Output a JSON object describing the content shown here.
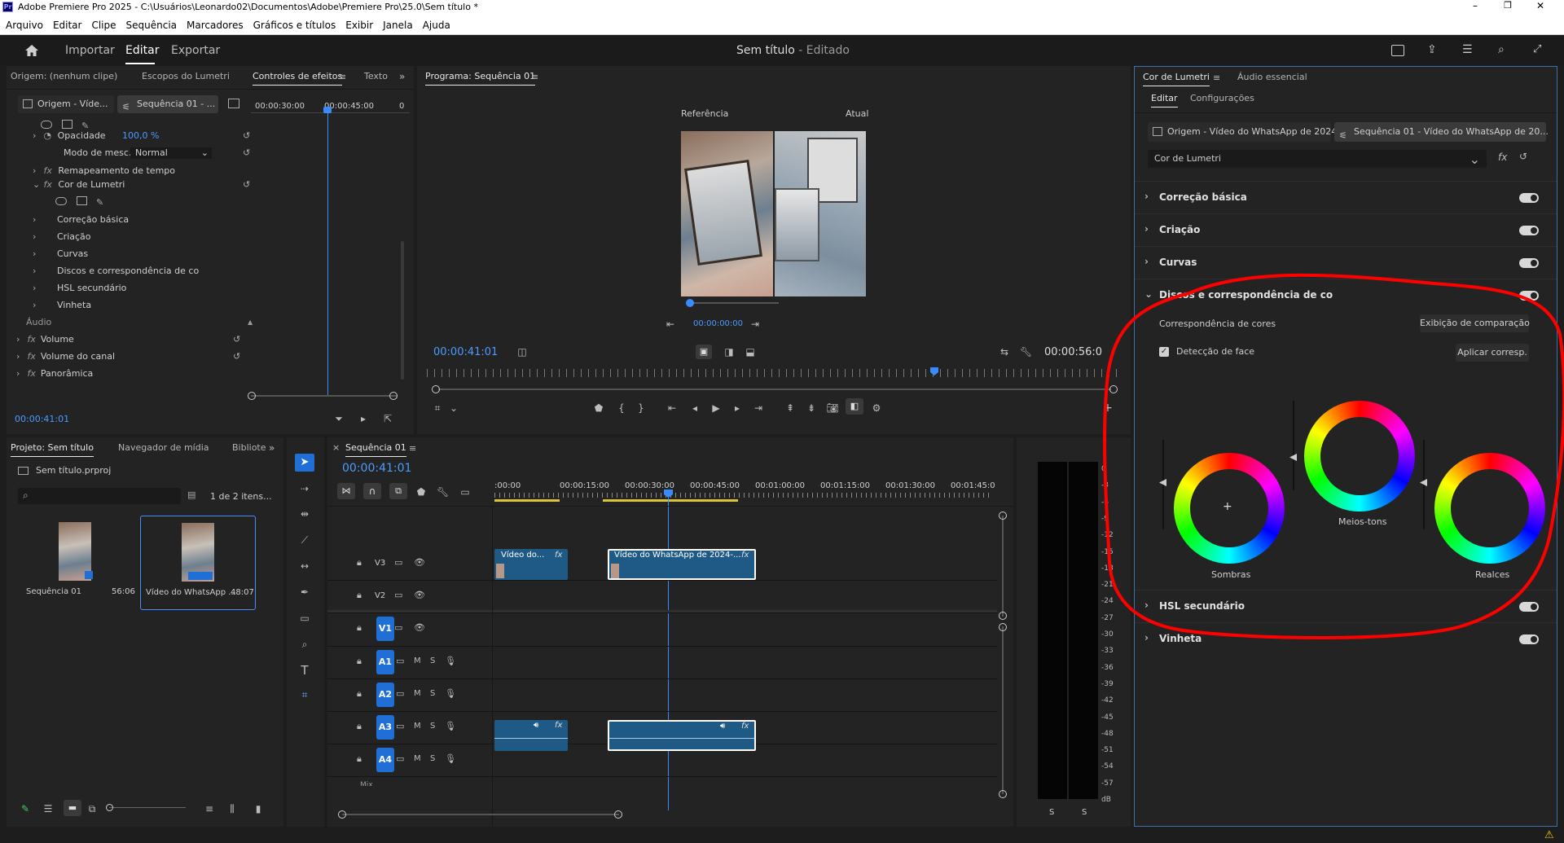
{
  "titlebar": {
    "app_title": "Adobe Premiere Pro 2025 - C:\\Usuários\\Leonardo02\\Documentos\\Adobe\\Premiere Pro\\25.0\\Sem título *"
  },
  "menu": [
    "Arquivo",
    "Editar",
    "Clipe",
    "Sequência",
    "Marcadores",
    "Gráficos e títulos",
    "Exibir",
    "Janela",
    "Ajuda"
  ],
  "workspace": {
    "tabs": [
      "Importar",
      "Editar",
      "Exportar"
    ],
    "active": "Editar",
    "doc_title": "Sem título",
    "doc_status": " - Editado"
  },
  "source_panel": {
    "tabs": [
      "Origem: (nenhum clipe)",
      "Escopos do Lumetri",
      "Controles de efeitos",
      "Texto"
    ],
    "clip_a": "Origem - Víde...",
    "clip_b": "Sequência 01 - ...",
    "ruler": [
      "00:00:30:00",
      "00:00:45:00",
      "0"
    ],
    "opacity_label": "Opacidade",
    "opacity_value": "100,0 %",
    "blend_label": "Modo de mesc...",
    "blend_value": "Normal",
    "time_remap": "Remapeamento de tempo",
    "lumetri": "Cor de Lumetri",
    "lumetri_items": [
      "Correção básica",
      "Criação",
      "Curvas",
      "Discos e correspondência de co",
      "HSL secundário",
      "Vinheta"
    ],
    "audio_header": "Áudio",
    "audio_items": [
      "Volume",
      "Volume do canal",
      "Panorâmica"
    ],
    "timecode": "00:00:41:01"
  },
  "program": {
    "title": "Programa: Sequência 01",
    "ref_label": "Referência",
    "cur_label": "Atual",
    "compare_tc": "00:00:00:00",
    "timecode": "00:00:41:01",
    "duration": "00:00:56:0"
  },
  "project": {
    "tabs": [
      "Projeto: Sem título",
      "Navegador de mídia",
      "Bibliote"
    ],
    "file": "Sem título.prproj",
    "count": "1 de 2 itens...",
    "items": [
      {
        "name": "Sequência 01",
        "dur": "56:06"
      },
      {
        "name": "Vídeo do WhatsApp ...",
        "dur": "48:07"
      }
    ]
  },
  "timeline": {
    "tab": "Sequência 01",
    "timecode": "00:00:41:01",
    "ruler": [
      ":00:00",
      "00:00:15:00",
      "00:00:30:00",
      "00:00:45:00",
      "00:01:00:00",
      "00:01:15:00",
      "00:01:30:00",
      "00:01:45:0"
    ],
    "video_tracks": [
      "V3",
      "V2",
      "V1"
    ],
    "audio_tracks": [
      "A1",
      "A2",
      "A3",
      "A4"
    ],
    "clip_v_short": "Vídeo do...",
    "clip_v_long": "Vídeo do WhatsApp de 2024-...",
    "fx": "fx",
    "mix_label": "Mix"
  },
  "meter": {
    "scale": [
      "0",
      "-3",
      "-6",
      "-9",
      "-12",
      "-15",
      "-18",
      "-21",
      "-24",
      "-27",
      "-30",
      "-33",
      "-36",
      "-39",
      "-42",
      "-45",
      "-48",
      "-51",
      "-54",
      "-57",
      "dB"
    ],
    "solo": [
      "S",
      "S"
    ]
  },
  "lumetri": {
    "tabs": [
      "Cor de Lumetri",
      "Áudio essencial"
    ],
    "subtabs": [
      "Editar",
      "Configurações"
    ],
    "clip_a": "Origem - Vídeo do WhatsApp de 2024-...",
    "clip_b": "Sequência 01 - Vídeo do WhatsApp de 20...",
    "effect": "Cor de Lumetri",
    "sections_top": [
      "Correção básica",
      "Criação",
      "Curvas"
    ],
    "wheels_section": "Discos e correspondência de co",
    "color_match": "Correspondência de cores",
    "compare_btn": "Exibição de comparação",
    "face_detect": "Detecção de face",
    "apply_btn": "Aplicar corresp.",
    "wheels": [
      "Sombras",
      "Meios-tons",
      "Realces"
    ],
    "sections_bottom": [
      "HSL secundário",
      "Vinheta"
    ]
  },
  "colors": {
    "accent": "#1f6fd6",
    "clip": "#1f5a86",
    "annotation": "#ff0000"
  }
}
